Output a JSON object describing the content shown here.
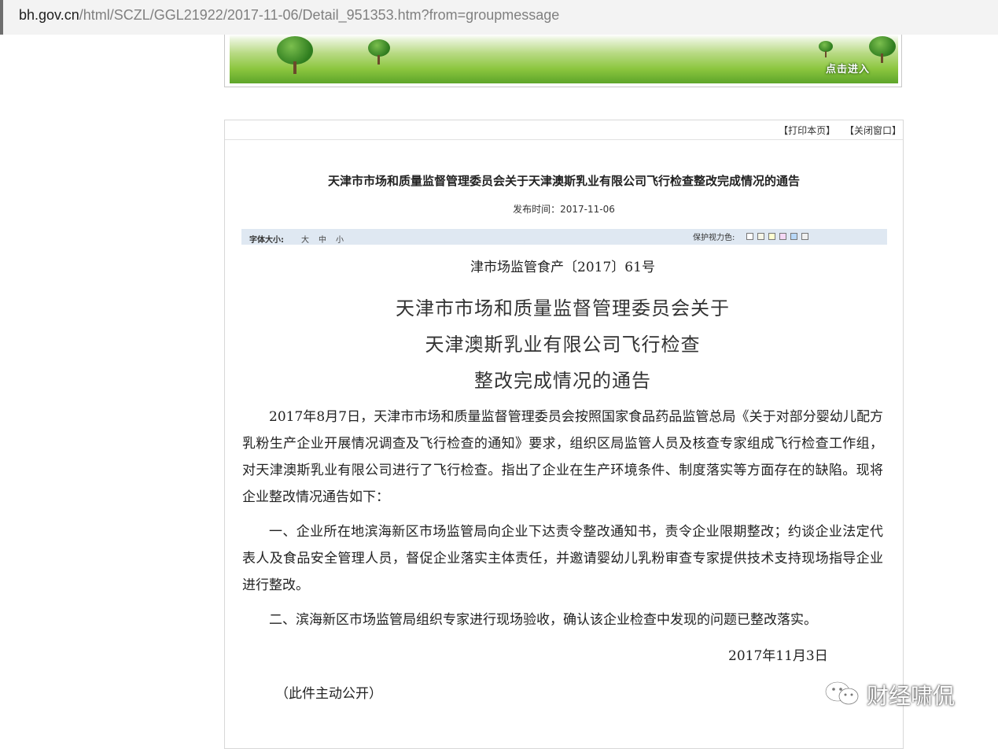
{
  "browser": {
    "url_host": "bh.gov.cn",
    "url_path": "/html/SCZL/GGL21922/2017-11-06/Detail_951353.htm?from=groupmessage"
  },
  "banner": {
    "enter_label": "点击进入"
  },
  "toplinks": {
    "print": "【打印本页】",
    "close": "【关闭窗口】"
  },
  "article": {
    "title": "天津市市场和质量监督管理委员会关于天津澳斯乳业有限公司飞行检查整改完成情况的通告",
    "pubtime_label": "发布时间：",
    "pubtime_value": "2017-11-06"
  },
  "toolbar": {
    "fontsize_label": "字体大小:",
    "fontsize_options": [
      "大",
      "中",
      "小"
    ],
    "protect_label": "保护视力色:",
    "swatch_colors": [
      "#ffffff",
      "#f6f6e8",
      "#ffffd0",
      "#f5d8f5",
      "#b8d8f8",
      "#f0f0f0"
    ]
  },
  "document": {
    "doc_number": "津市场监管食产〔2017〕61号",
    "title_lines": [
      "天津市市场和质量监督管理委员会关于",
      "天津澳斯乳业有限公司飞行检查",
      "整改完成情况的通告"
    ],
    "paragraphs": [
      "2017年8月7日，天津市市场和质量监督管理委员会按照国家食品药品监管总局《关于对部分婴幼儿配方乳粉生产企业开展情况调查及飞行检查的通知》要求，组织区局监管人员及核查专家组成飞行检查工作组，对天津澳斯乳业有限公司进行了飞行检查。指出了企业在生产环境条件、制度落实等方面存在的缺陷。现将企业整改情况通告如下：",
      "一、企业所在地滨海新区市场监管局向企业下达责令整改通知书，责令企业限期整改；约谈企业法定代表人及食品安全管理人员，督促企业落实主体责任，并邀请婴幼儿乳粉审查专家提供技术支持现场指导企业进行整改。",
      "二、滨海新区市场监管局组织专家进行现场验收，确认该企业检查中发现的问题已整改落实。"
    ],
    "date": "2017年11月3日",
    "public_note": "（此件主动公开）"
  },
  "watermark": {
    "text": "财经啸侃"
  }
}
